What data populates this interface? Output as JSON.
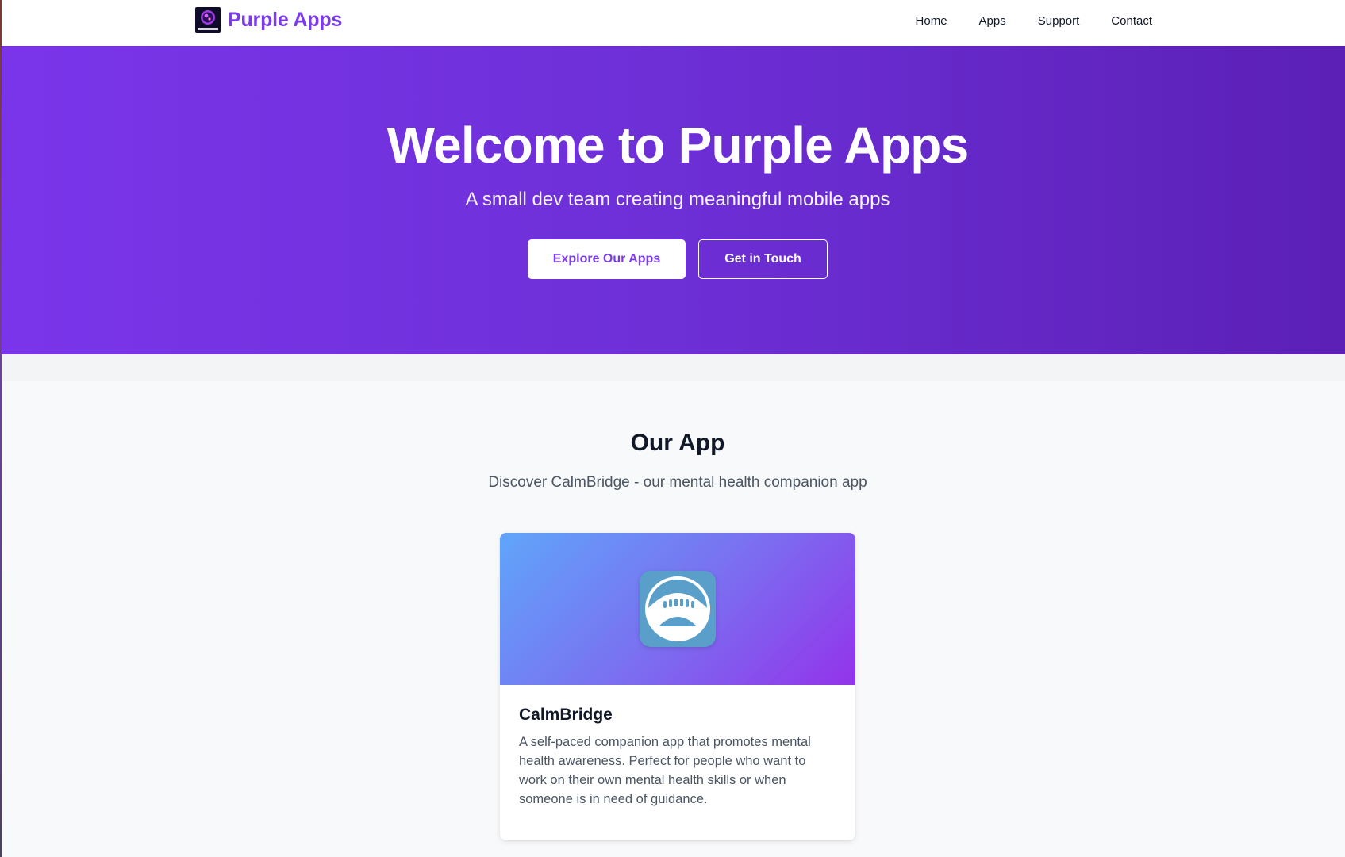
{
  "header": {
    "brand_name": "Purple Apps",
    "logo_text": "PurpleApps",
    "nav": [
      {
        "label": "Home"
      },
      {
        "label": "Apps"
      },
      {
        "label": "Support"
      },
      {
        "label": "Contact"
      }
    ]
  },
  "hero": {
    "title": "Welcome to Purple Apps",
    "subtitle": "A small dev team creating meaningful mobile apps",
    "primary_button": "Explore Our Apps",
    "secondary_button": "Get in Touch"
  },
  "apps_section": {
    "title": "Our App",
    "subtitle": "Discover CalmBridge - our mental health companion app",
    "cards": [
      {
        "name": "CalmBridge",
        "icon": "bridge-icon",
        "description": "A self-paced companion app that promotes mental health awareness. Perfect for people who want to work on their own mental health skills or when someone is in need of guidance."
      }
    ]
  },
  "colors": {
    "brand": "#7c3aed",
    "hero_start": "#7a35ea",
    "hero_end": "#5b20b6",
    "page_bg": "#f8f9fb",
    "card_media_start": "#60a5fa",
    "card_media_end": "#9333ea",
    "app_icon_bg": "#5a9fca"
  }
}
